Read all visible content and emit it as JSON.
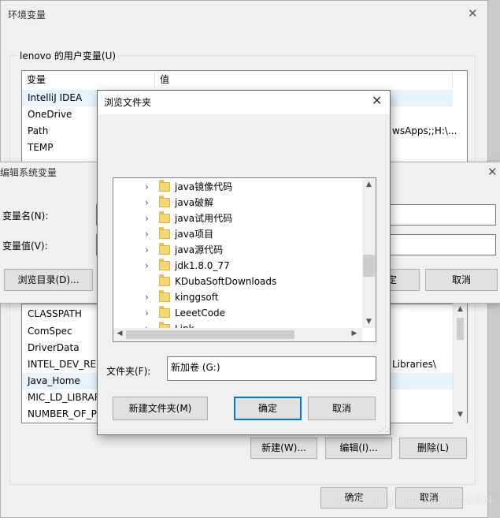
{
  "env_dialog": {
    "title": "环境变量",
    "user_group_label": "lenovo 的用户变量(U)",
    "columns": [
      "变量",
      "值"
    ],
    "user_vars": [
      {
        "name": "IntelliJ IDEA",
        "value": ""
      },
      {
        "name": "OneDrive",
        "value": ""
      },
      {
        "name": "Path",
        "value": "wsApps;;H:\\..."
      },
      {
        "name": "TEMP",
        "value": ""
      }
    ],
    "sys_vars": [
      {
        "name": "CLASSPATH",
        "value": ""
      },
      {
        "name": "ComSpec",
        "value": ""
      },
      {
        "name": "DriverData",
        "value": ""
      },
      {
        "name": "INTEL_DEV_RED",
        "value": "Libraries\\"
      },
      {
        "name": "Java_Home",
        "value": ""
      },
      {
        "name": "MIC_LD_LIBRAR",
        "value": ""
      },
      {
        "name": "NUMBER_OF_P",
        "value": ""
      }
    ],
    "buttons": {
      "new": "新建(W)...",
      "edit": "编辑(I)...",
      "delete": "删除(L)",
      "ok": "确定",
      "cancel": "取消"
    }
  },
  "edit_dialog": {
    "title": "编辑系统变量",
    "name_label": "变量名(N):",
    "value_label": "变量值(V):",
    "browse_dir": "浏览目录(D)...",
    "ok": "定",
    "cancel": "取消"
  },
  "browse_dialog": {
    "title": "浏览文件夹",
    "tree": [
      {
        "label": "java镜像代码",
        "expandable": true
      },
      {
        "label": "java破解",
        "expandable": true
      },
      {
        "label": "java试用代码",
        "expandable": true
      },
      {
        "label": "java项目",
        "expandable": true
      },
      {
        "label": "java源代码",
        "expandable": true
      },
      {
        "label": "jdk1.8.0_77",
        "expandable": true
      },
      {
        "label": "KDubaSoftDownloads",
        "expandable": false
      },
      {
        "label": "kinggsoft",
        "expandable": true
      },
      {
        "label": "LeeetCode",
        "expandable": true
      },
      {
        "label": "Link",
        "expandable": true
      }
    ],
    "folder_label": "文件夹(F):",
    "folder_value": "新加卷 (G:)",
    "new_folder": "新建文件夹(M)",
    "ok": "确定",
    "cancel": "取消"
  },
  "watermark": "https://blog.csdn.net/lp210304"
}
